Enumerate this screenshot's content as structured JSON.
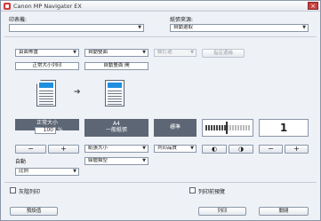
{
  "window": {
    "title": "Canon MP Navigator EX",
    "close": "×"
  },
  "printer": {
    "label": "印表機:",
    "value": ""
  },
  "paper_source": {
    "label": "紙張來源:",
    "value": "自動選取"
  },
  "toolbar": {
    "page_layout": "頁面佈置",
    "duplex": "自動雙面",
    "binding": "裝訂邊",
    "specify_margin": "指定邊緣"
  },
  "modes": {
    "left": "正常大小列印",
    "right": "自動雙面 開"
  },
  "size_panel": {
    "title": "正常大小",
    "percent_value": "100",
    "percent_unit": "%"
  },
  "paper_panel": {
    "size": "A4",
    "type": "一般紙張"
  },
  "quality_panel": {
    "label": "標準"
  },
  "intensity_panel": {
    "level": 8
  },
  "copies_panel": {
    "value": "1"
  },
  "controls": {
    "minus": "−",
    "plus": "+",
    "auto": "自動",
    "ratio": "比例",
    "paper_size": "紙張大小",
    "media_type": "媒體類型",
    "print_quality": "列印品質"
  },
  "checkboxes": {
    "grayscale": "灰階列印",
    "preview": "列印前預覽"
  },
  "footer": {
    "defaults": "預設值",
    "print": "列印",
    "close": "關閉"
  }
}
